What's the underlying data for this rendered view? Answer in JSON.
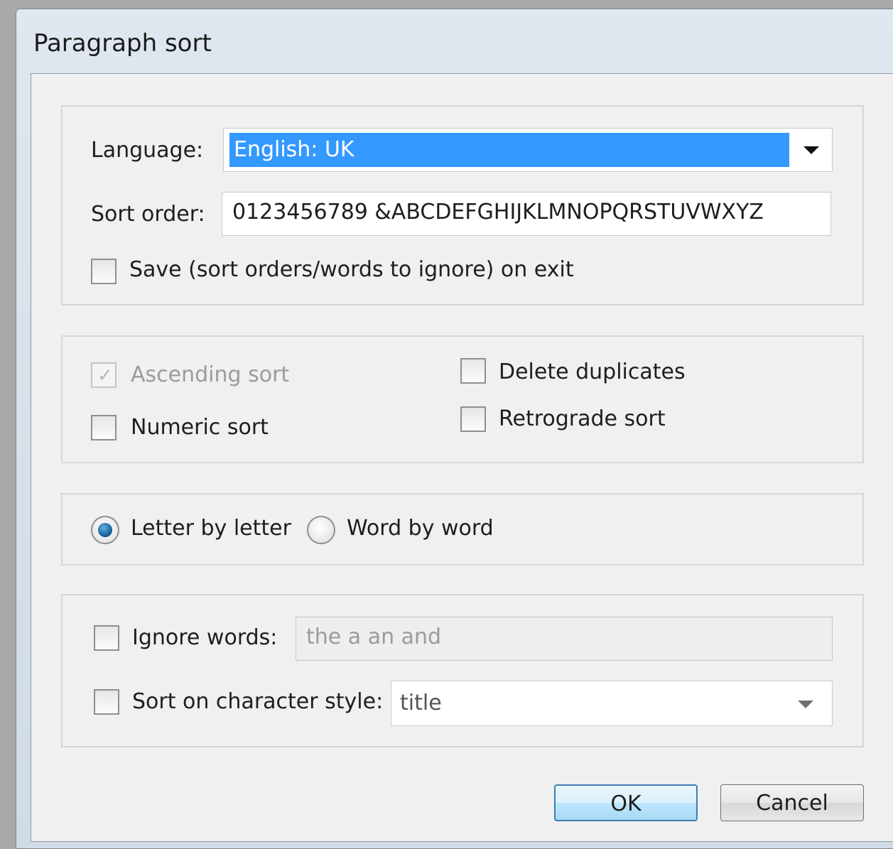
{
  "dialog": {
    "title": "Paragraph sort"
  },
  "language": {
    "label": "Language:",
    "value": "English: UK"
  },
  "sort_order": {
    "label": "Sort order:",
    "value": "0123456789 &ABCDEFGHIJKLMNOPQRSTUVWXYZ"
  },
  "save_option": {
    "label": "Save (sort orders/words to ignore) on exit",
    "checked": false
  },
  "options": {
    "ascending_sort": {
      "label": "Ascending sort",
      "checked": true,
      "enabled": false
    },
    "numeric_sort": {
      "label": "Numeric sort",
      "checked": false
    },
    "delete_duplicates": {
      "label": "Delete duplicates",
      "checked": false
    },
    "retrograde_sort": {
      "label": "Retrograde sort",
      "checked": false
    }
  },
  "sort_mode": {
    "letter_by_letter": {
      "label": "Letter by letter",
      "selected": true
    },
    "word_by_word": {
      "label": "Word by word",
      "selected": false
    }
  },
  "ignore_words": {
    "label": "Ignore words:",
    "value": "the a an and",
    "checked": false
  },
  "char_style": {
    "label": "Sort on character style:",
    "value": "title",
    "checked": false
  },
  "buttons": {
    "ok": "OK",
    "cancel": "Cancel"
  },
  "colors": {
    "selection": "#3399ff",
    "default_button_border": "#3c7fb1"
  }
}
